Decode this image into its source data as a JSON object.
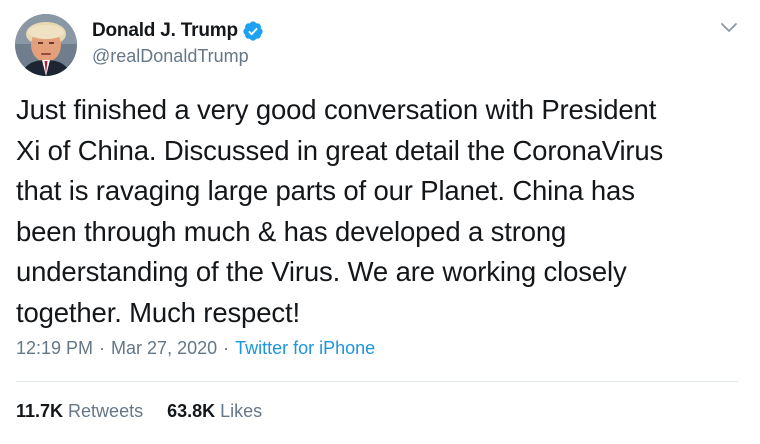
{
  "author": {
    "display_name": "Donald J. Trump",
    "handle": "@realDonaldTrump",
    "verified": true,
    "avatar_icon": "profile-photo",
    "verified_icon": "verified-badge-icon"
  },
  "tweet": {
    "text": "Just finished a very good conversation with President\nXi of China. Discussed in great detail the CoronaVirus\nthat is ravaging large parts of our Planet. China has\nbeen through much & has developed a strong\nunderstanding of the Virus. We are working closely\ntogether. Much respect!",
    "time": "12:19 PM",
    "date": "Mar 27, 2020",
    "separator": "·",
    "source": "Twitter for iPhone"
  },
  "stats": {
    "retweets_count": "11.7K",
    "retweets_label": "Retweets",
    "likes_count": "63.8K",
    "likes_label": "Likes"
  },
  "colors": {
    "text_primary": "#14171a",
    "text_secondary": "#657786",
    "link": "#1b95e0",
    "verified": "#1da1f2",
    "divider": "#e1e8ed"
  },
  "icons": {
    "menu": "chevron-down-icon"
  }
}
